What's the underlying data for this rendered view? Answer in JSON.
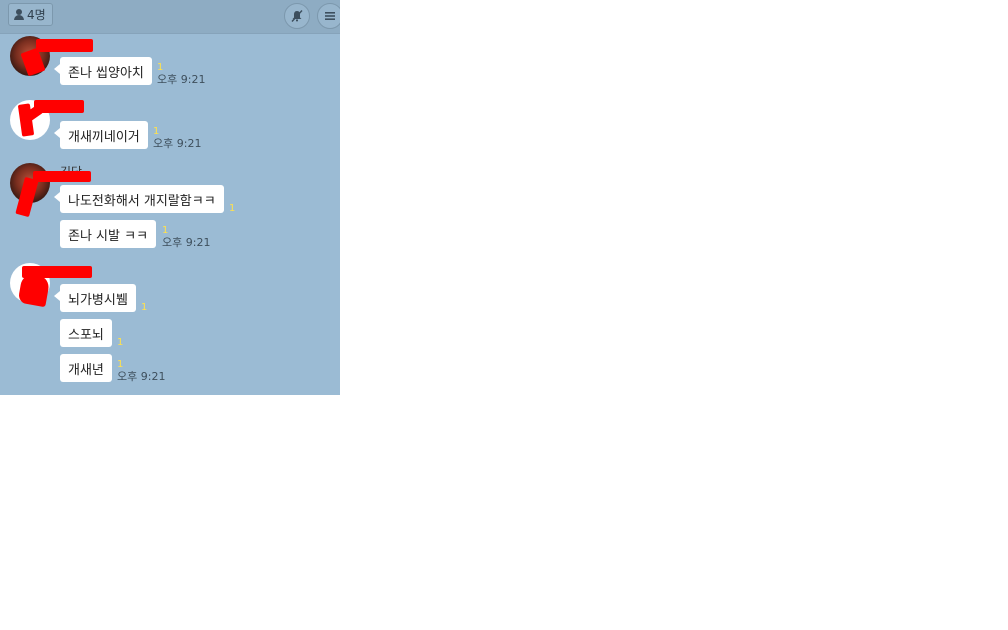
{
  "header": {
    "member_count": "4명",
    "icons": {
      "members": "person-icon",
      "mute": "mute-icon",
      "menu": "menu-icon"
    }
  },
  "colors": {
    "chat_bg": "#9bbbd4",
    "bubble": "#ffffff",
    "unread": "#ffe14d",
    "redaction": "#ff0000"
  },
  "messages": [
    {
      "group": 1,
      "text": "존나 씹양아치",
      "unread": "1",
      "time": "오후 9:21"
    },
    {
      "group": 2,
      "text": "개새끼네이거",
      "unread": "1",
      "time": "오후 9:21"
    },
    {
      "group": 3,
      "sender_partial": "김당",
      "text": "나도전화해서 개지랄함ㅋㅋ",
      "unread": "1",
      "time": ""
    },
    {
      "group": 3,
      "text": "존나 시발 ㅋㅋ",
      "unread": "1",
      "time": "오후 9:21"
    },
    {
      "group": 4,
      "text": "뇌가병시뷈",
      "unread": "1",
      "time": ""
    },
    {
      "group": 4,
      "text": "스포뇌",
      "unread": "1",
      "time": ""
    },
    {
      "group": 4,
      "text": "개새년",
      "unread": "1",
      "time": "오후 9:21"
    }
  ]
}
